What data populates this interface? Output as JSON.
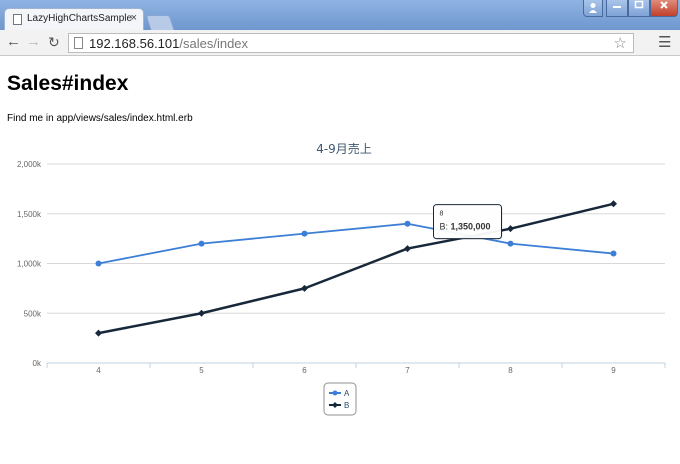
{
  "browser": {
    "tab_title": "LazyHighChartsSample",
    "tab_close": "×",
    "url_host": "192.168.56.101",
    "url_path": "/sales/index"
  },
  "page": {
    "title": "Sales#index",
    "description": "Find me in app/views/sales/index.html.erb"
  },
  "chart_data": {
    "type": "line",
    "title": "4-9月売上",
    "xlabel": "",
    "ylabel": "",
    "categories": [
      "4",
      "5",
      "6",
      "7",
      "8",
      "9"
    ],
    "ylim": [
      0,
      2000000
    ],
    "yticks": [
      "0k",
      "500k",
      "1,000k",
      "1,500k",
      "2,000k"
    ],
    "grid": true,
    "legend": "bottom-center",
    "series": [
      {
        "name": "A",
        "color": "#3d7fd6",
        "values": [
          1000000,
          1200000,
          1300000,
          1400000,
          1200000,
          1100000
        ]
      },
      {
        "name": "B",
        "color": "#18283b",
        "values": [
          300000,
          500000,
          750000,
          1150000,
          1350000,
          1600000
        ]
      }
    ],
    "tooltip": {
      "header": "8",
      "series": "B",
      "label": "B:",
      "value": "1,350,000"
    }
  }
}
